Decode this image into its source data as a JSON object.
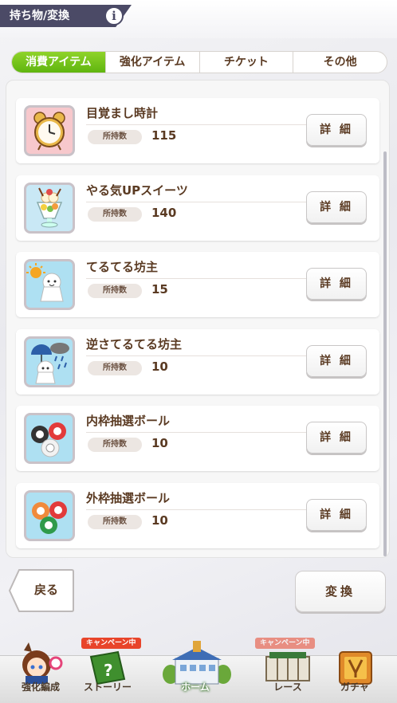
{
  "header": {
    "title": "持ち物/変換",
    "info_glyph": "i"
  },
  "tabs": [
    {
      "label": "消費アイテム",
      "active": true
    },
    {
      "label": "強化アイテム",
      "active": false
    },
    {
      "label": "チケット",
      "active": false
    },
    {
      "label": "その他",
      "active": false
    }
  ],
  "own_label": "所持数",
  "detail_label": "詳 細",
  "items": [
    {
      "name": "目覚まし時計",
      "count": "115",
      "icon": "alarm-clock-icon"
    },
    {
      "name": "やる気UPスイーツ",
      "count": "140",
      "icon": "parfait-icon"
    },
    {
      "name": "てるてる坊主",
      "count": "15",
      "icon": "teru-teru-bozu-icon"
    },
    {
      "name": "逆さてるてる坊主",
      "count": "10",
      "icon": "upside-down-teru-teru-bozu-icon"
    },
    {
      "name": "内枠抽選ボール",
      "count": "10",
      "icon": "inner-lottery-balls-icon"
    },
    {
      "name": "外枠抽選ボール",
      "count": "10",
      "icon": "outer-lottery-balls-icon"
    }
  ],
  "buttons": {
    "back": "戻る",
    "convert": "変換"
  },
  "nav": [
    {
      "label": "強化編成",
      "icon": "character-icon"
    },
    {
      "label": "ストーリー",
      "icon": "story-book-icon",
      "badge": "キャンペーン中"
    },
    {
      "label": "ホーム",
      "icon": "home-building-icon"
    },
    {
      "label": "レース",
      "icon": "race-gate-icon",
      "badge": "キャンペーン中"
    },
    {
      "label": "ガチャ",
      "icon": "gacha-icon"
    }
  ],
  "colors": {
    "accent_green": "#6cc11a",
    "header_dark": "#4b4a66",
    "text_brown": "#5a3a22",
    "campaign_red": "#e8442a"
  }
}
